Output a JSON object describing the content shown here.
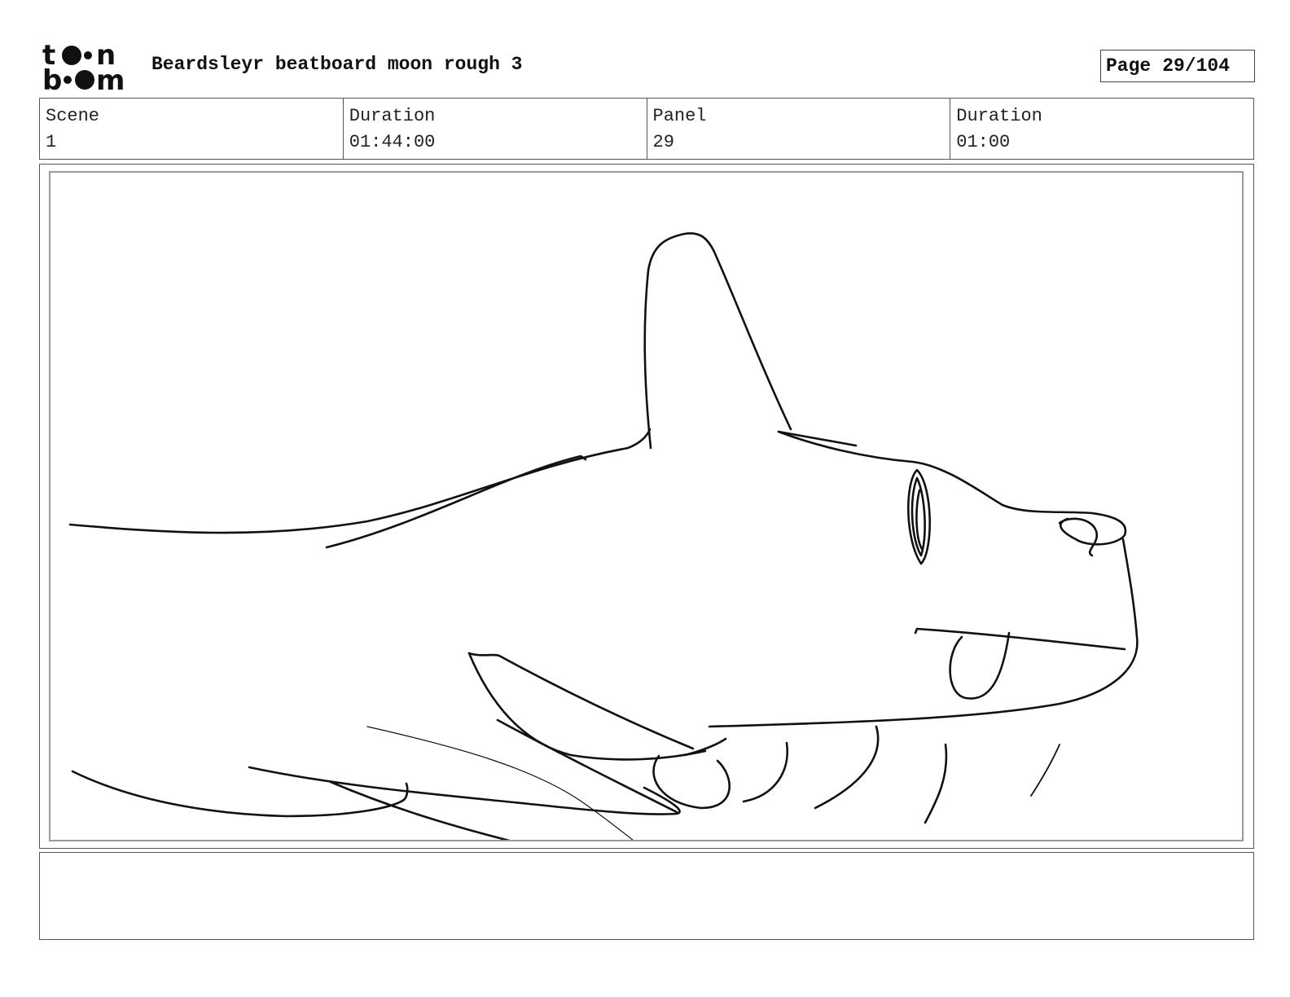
{
  "header": {
    "logo_text": "toonboom",
    "title": "Beardsleyr beatboard moon rough 3",
    "page_label": "Page",
    "page_value": "29/104"
  },
  "info": {
    "scene_label": "Scene",
    "scene_value": "1",
    "duration_label": "Duration",
    "duration_value": "01:44:00",
    "panel_label": "Panel",
    "panel_value": "29",
    "panel_duration_label": "Duration",
    "panel_duration_value": "01:00"
  },
  "panel": {
    "content": "sketch-drawing"
  },
  "notes": {
    "text": ""
  }
}
